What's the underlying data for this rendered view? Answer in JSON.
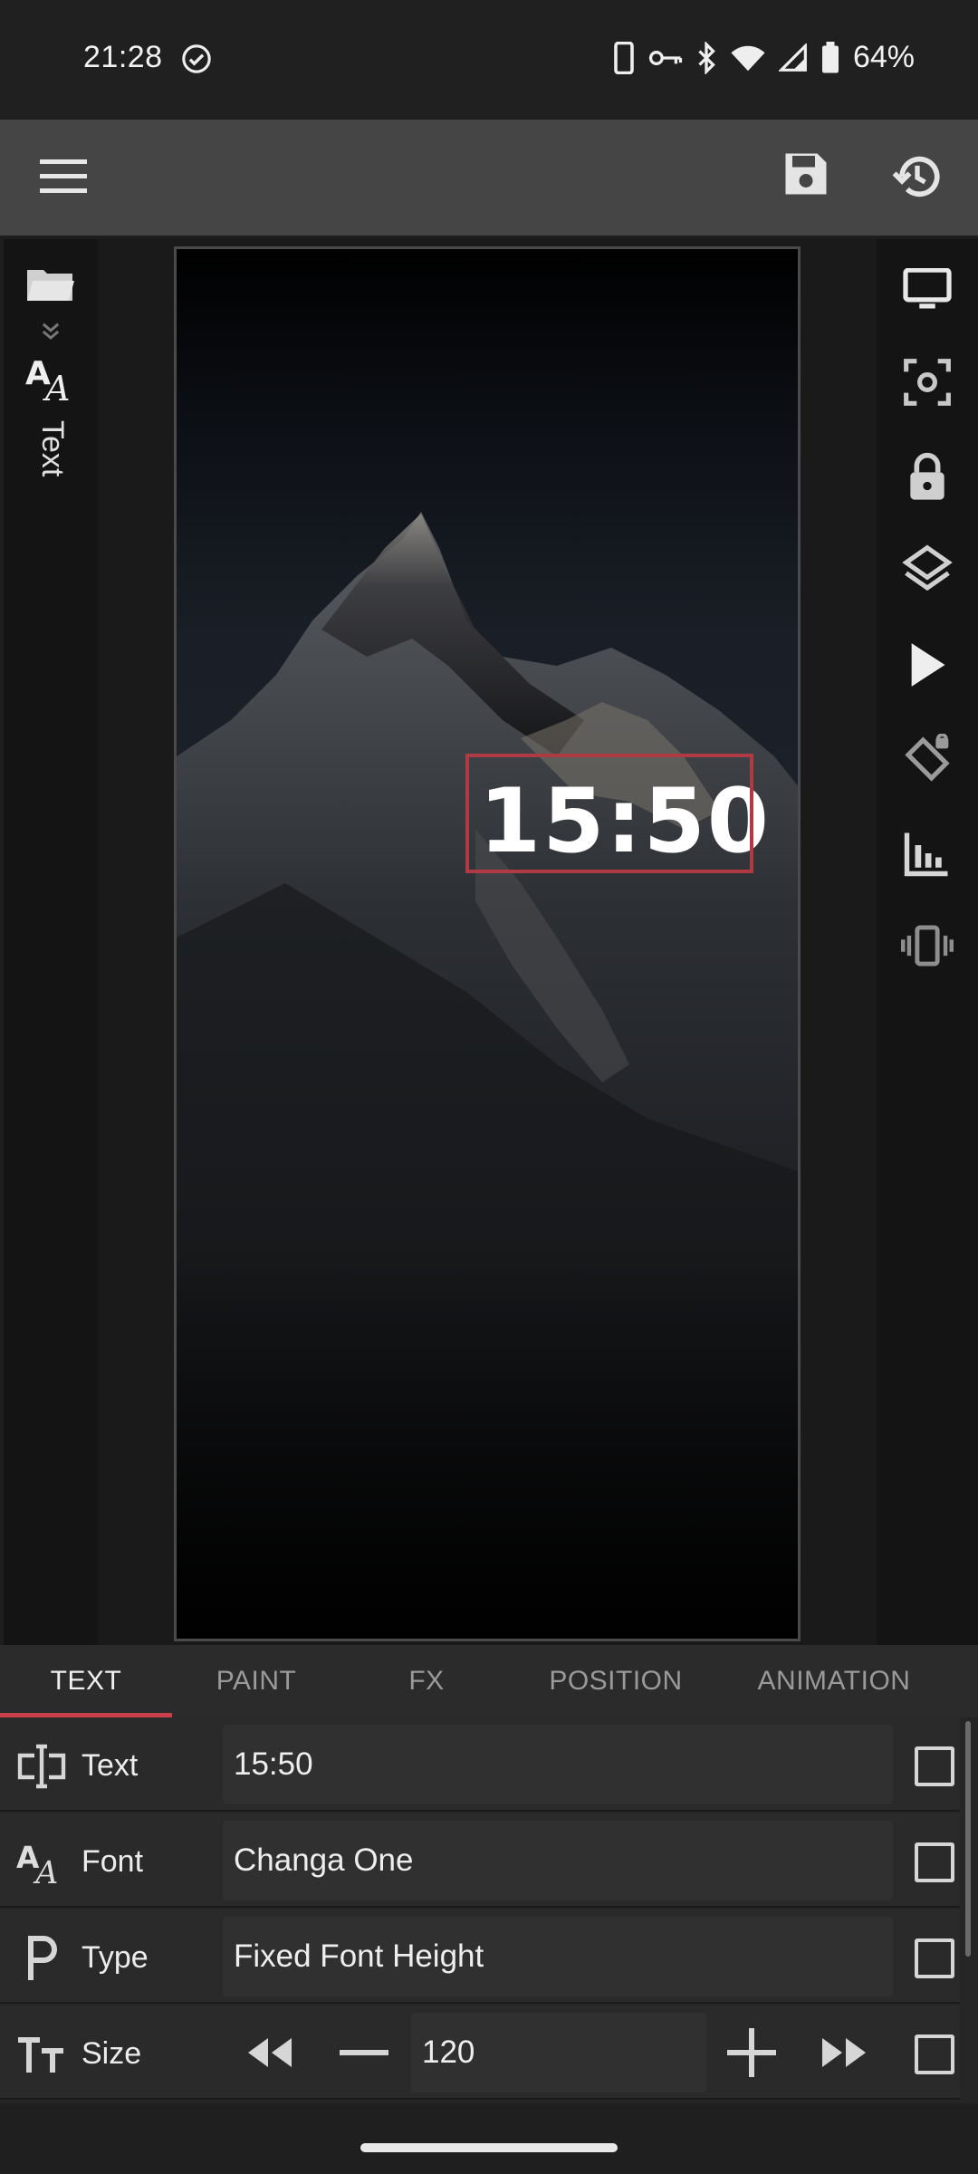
{
  "status_bar": {
    "time": "21:28",
    "battery_text": "64%",
    "icons": [
      "check-circle-icon",
      "phone-icon",
      "vpn-key-icon",
      "bluetooth-icon",
      "wifi-icon",
      "signal-icon",
      "battery-icon"
    ]
  },
  "toolbar": {
    "icons": [
      "menu-icon",
      "save-icon",
      "history-icon"
    ]
  },
  "left_rail": {
    "label": "Text",
    "icons": [
      "folder-icon",
      "chevron-double-down-icon",
      "font-icon"
    ]
  },
  "canvas": {
    "clock_text": "15:50"
  },
  "right_rail": {
    "icons": [
      "monitor-icon",
      "screenshot-icon",
      "lock-icon",
      "layers-icon",
      "play-icon",
      "screen-lock-rotation-icon",
      "chart-icon",
      "vibrate-icon"
    ]
  },
  "tabs": [
    {
      "label": "TEXT",
      "active": true
    },
    {
      "label": "PAINT",
      "active": false
    },
    {
      "label": "FX",
      "active": false
    },
    {
      "label": "POSITION",
      "active": false
    },
    {
      "label": "ANIMATION",
      "active": false
    }
  ],
  "properties": {
    "text": {
      "label": "Text",
      "value": "15:50"
    },
    "font": {
      "label": "Font",
      "value": "Changa One"
    },
    "type": {
      "label": "Type",
      "value": "Fixed Font Height"
    },
    "size": {
      "label": "Size",
      "value": "120"
    }
  },
  "colors": {
    "accent": "#c8404a",
    "selection": "#b03a44",
    "toolbar": "#454545",
    "background": "#1d1d1d"
  }
}
